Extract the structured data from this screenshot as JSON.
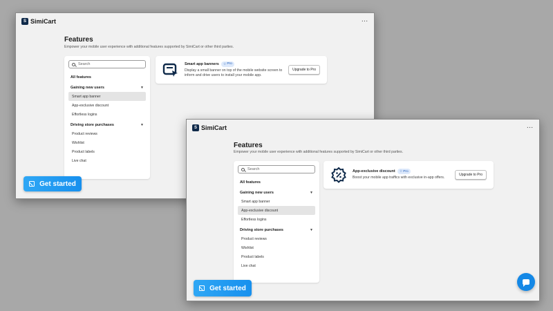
{
  "app": {
    "brand": "SimiCart",
    "logo_letter": "S",
    "more_menu": "…"
  },
  "page": {
    "title": "Features",
    "subtitle": "Empower your mobile user experience with additional features supported by SimiCart or other third parties."
  },
  "search": {
    "placeholder": "Search"
  },
  "nav": {
    "all_features": "All features",
    "groups": [
      {
        "label": "Gaining new users",
        "items": [
          "Smart app banner",
          "App-exclusive discount",
          "Effortless logins"
        ]
      },
      {
        "label": "Driving store purchases",
        "items": [
          "Product reviews",
          "Wishlist",
          "Product labels",
          "Live chat"
        ]
      }
    ]
  },
  "windows": [
    {
      "active_item": "Smart app banner",
      "card": {
        "title": "Smart app banners",
        "badge": "Pro",
        "description": "Display a small banner on top of the mobile website screen to inform and drive users to install your mobile app.",
        "button": "Upgrade to Pro",
        "icon": "smart-banner-icon"
      }
    },
    {
      "active_item": "App-exclusive discount",
      "card": {
        "title": "App-exclusive discount",
        "badge": "Pro",
        "description": "Boost your mobile app traffics with exclusive in-app offers.",
        "button": "Upgrade to Pro",
        "icon": "discount-badge-icon"
      }
    }
  ],
  "cta": {
    "label": "Get started"
  },
  "colors": {
    "accent": "#1790ee",
    "brand_dark": "#0f2a4a",
    "pro_badge_bg": "#dde9fb",
    "pro_badge_text": "#1e5bb8"
  }
}
